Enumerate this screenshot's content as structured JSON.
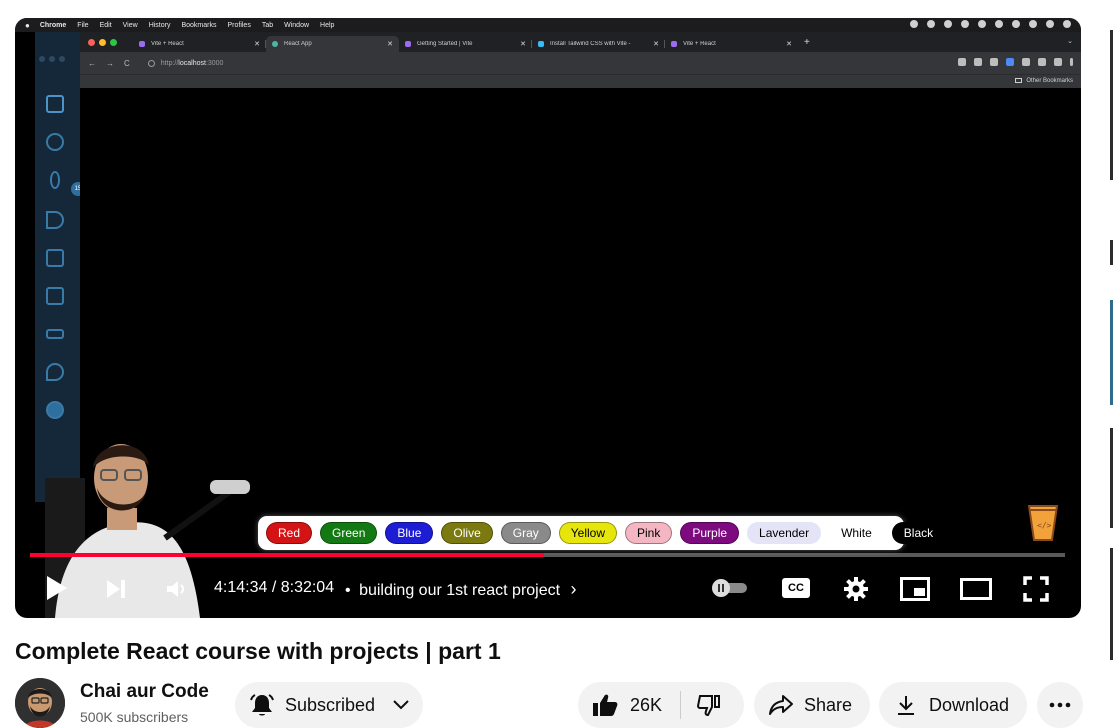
{
  "mac_menubar": {
    "app": "Chrome",
    "menus": [
      "File",
      "Edit",
      "View",
      "History",
      "Bookmarks",
      "Profiles",
      "Tab",
      "Window",
      "Help"
    ]
  },
  "vscode": {
    "badge": "15"
  },
  "browser": {
    "tabs": [
      {
        "title": "Vite + React",
        "icon": "vite-icon"
      },
      {
        "title": "React App",
        "icon": "react-icon",
        "active": true
      },
      {
        "title": "Getting Started | Vite",
        "icon": "vite-icon"
      },
      {
        "title": "Install Tailwind CSS with Vite -",
        "icon": "tailwind-icon"
      },
      {
        "title": "Vite + React",
        "icon": "vite-icon"
      }
    ],
    "url_prefix": "http://",
    "url_host": "localhost",
    "url_port": ":3000",
    "other_bookmarks": "Other Bookmarks"
  },
  "color_buttons": [
    {
      "label": "Red",
      "bg": "#d41414",
      "fg": "#ffffff"
    },
    {
      "label": "Green",
      "bg": "#137a13",
      "fg": "#ffffff"
    },
    {
      "label": "Blue",
      "bg": "#1d1dd6",
      "fg": "#ffffff"
    },
    {
      "label": "Olive",
      "bg": "#7a7a10",
      "fg": "#ffffff"
    },
    {
      "label": "Gray",
      "bg": "#8a8a8a",
      "fg": "#ffffff"
    },
    {
      "label": "Yellow",
      "bg": "#e6e60c",
      "fg": "#000000"
    },
    {
      "label": "Pink",
      "bg": "#f4b6c2",
      "fg": "#000000"
    },
    {
      "label": "Purple",
      "bg": "#7e0a80",
      "fg": "#ffffff"
    },
    {
      "label": "Lavender",
      "bg": "#e4e4f7",
      "fg": "#000000"
    },
    {
      "label": "White",
      "bg": "#ffffff",
      "fg": "#000000"
    },
    {
      "label": "Black",
      "bg": "#000000",
      "fg": "#ffffff"
    }
  ],
  "player": {
    "time": "4:14:34 / 8:32:04",
    "separator": "•",
    "chapter": "building our 1st react project",
    "cc_label": "CC",
    "progress_fraction": 0.497,
    "accent": "#ff0033"
  },
  "video": {
    "title": "Complete React course with projects | part 1",
    "channel": "Chai aur Code",
    "subscribers": "500K subscribers",
    "subscribed_label": "Subscribed",
    "likes": "26K",
    "share_label": "Share",
    "download_label": "Download"
  }
}
